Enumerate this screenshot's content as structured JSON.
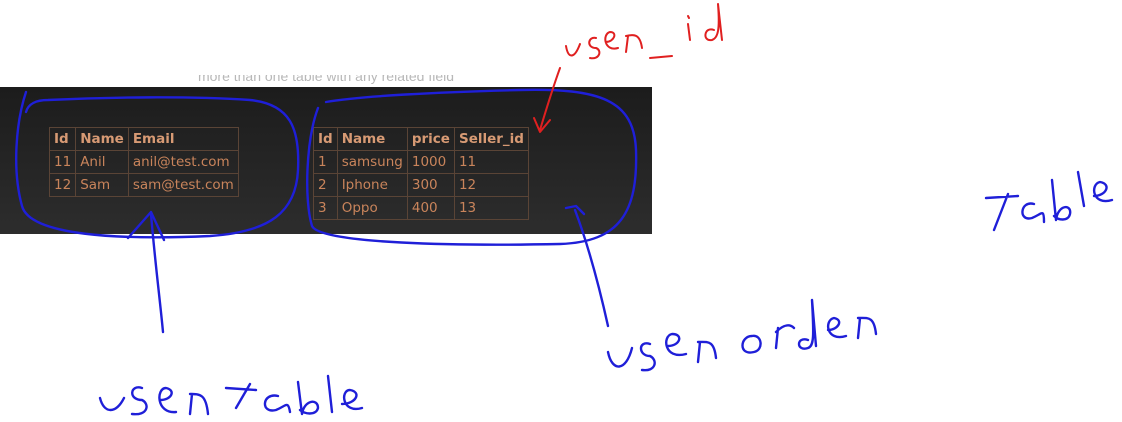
{
  "caption": "more than one table with any related field",
  "users_table": {
    "columns": [
      "Id",
      "Name",
      "Email"
    ],
    "rows": [
      [
        "11",
        "Anil",
        "anil@test.com"
      ],
      [
        "12",
        "Sam",
        "sam@test.com"
      ]
    ]
  },
  "orders_table": {
    "columns": [
      "Id",
      "Name",
      "price",
      "Seller_id"
    ],
    "rows": [
      [
        "1",
        "samsung",
        "1000",
        "11"
      ],
      [
        "2",
        "Iphone",
        "300",
        "12"
      ],
      [
        "3",
        "Oppo",
        "400",
        "13"
      ]
    ]
  },
  "annotations": {
    "user_table": "user table",
    "user_order_table": "user order table",
    "user_id": "user_id",
    "ink_color": "#1f1fd8",
    "red_ink_color": "#e02020"
  }
}
